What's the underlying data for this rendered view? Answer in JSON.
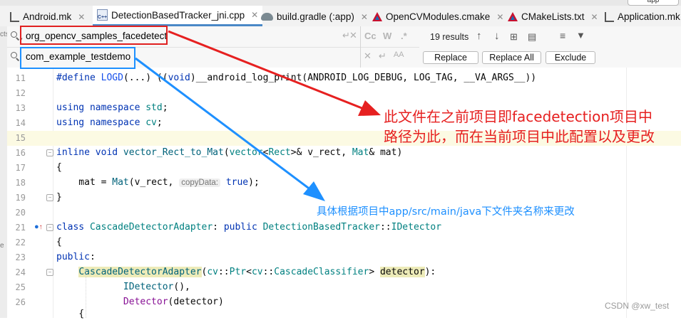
{
  "tabs": [
    {
      "label": "Android.mk",
      "icon": "makefile-icon",
      "active": false
    },
    {
      "label": "DetectionBasedTracker_jni.cpp",
      "icon": "cpp-file-icon",
      "active": true
    },
    {
      "label": "build.gradle (:app)",
      "icon": "gradle-elephant-icon",
      "active": false
    },
    {
      "label": "OpenCVModules.cmake",
      "icon": "cmake-icon",
      "active": false
    },
    {
      "label": "CMakeLists.txt",
      "icon": "cmake-icon",
      "active": false
    },
    {
      "label": "Application.mk",
      "icon": "makefile-icon",
      "active": false
    }
  ],
  "corner_button": "app",
  "find": {
    "search_value": "org_opencv_samples_facedetect",
    "replace_value": "com_example_testdemo",
    "options": [
      "Cc",
      "W",
      ".*"
    ],
    "results": "19 results",
    "replace_label": "Replace",
    "replace_all_label": "Replace All",
    "exclude_label": "Exclude"
  },
  "left_stubs": [
    "cts",
    "e"
  ],
  "editor": {
    "hint_label": "copyData:",
    "lines": [
      {
        "num": "11"
      },
      {
        "num": "12"
      },
      {
        "num": "13"
      },
      {
        "num": "14"
      },
      {
        "num": "15"
      },
      {
        "num": "16"
      },
      {
        "num": "17"
      },
      {
        "num": "18"
      },
      {
        "num": "19"
      },
      {
        "num": "20"
      },
      {
        "num": "21"
      },
      {
        "num": "22"
      },
      {
        "num": "23"
      },
      {
        "num": "24"
      },
      {
        "num": "25"
      },
      {
        "num": "26"
      }
    ]
  },
  "annotations": {
    "red_line1": "此文件在之前项目即facedetection项目中",
    "red_line2": "路径为此，而在当前项目中此配置以及更改",
    "blue": "具体根据项目中app/src/main/java下文件夹名称来更改",
    "red_color": "#e62020",
    "blue_color": "#1e90ff"
  },
  "watermark": "CSDN @xw_test"
}
